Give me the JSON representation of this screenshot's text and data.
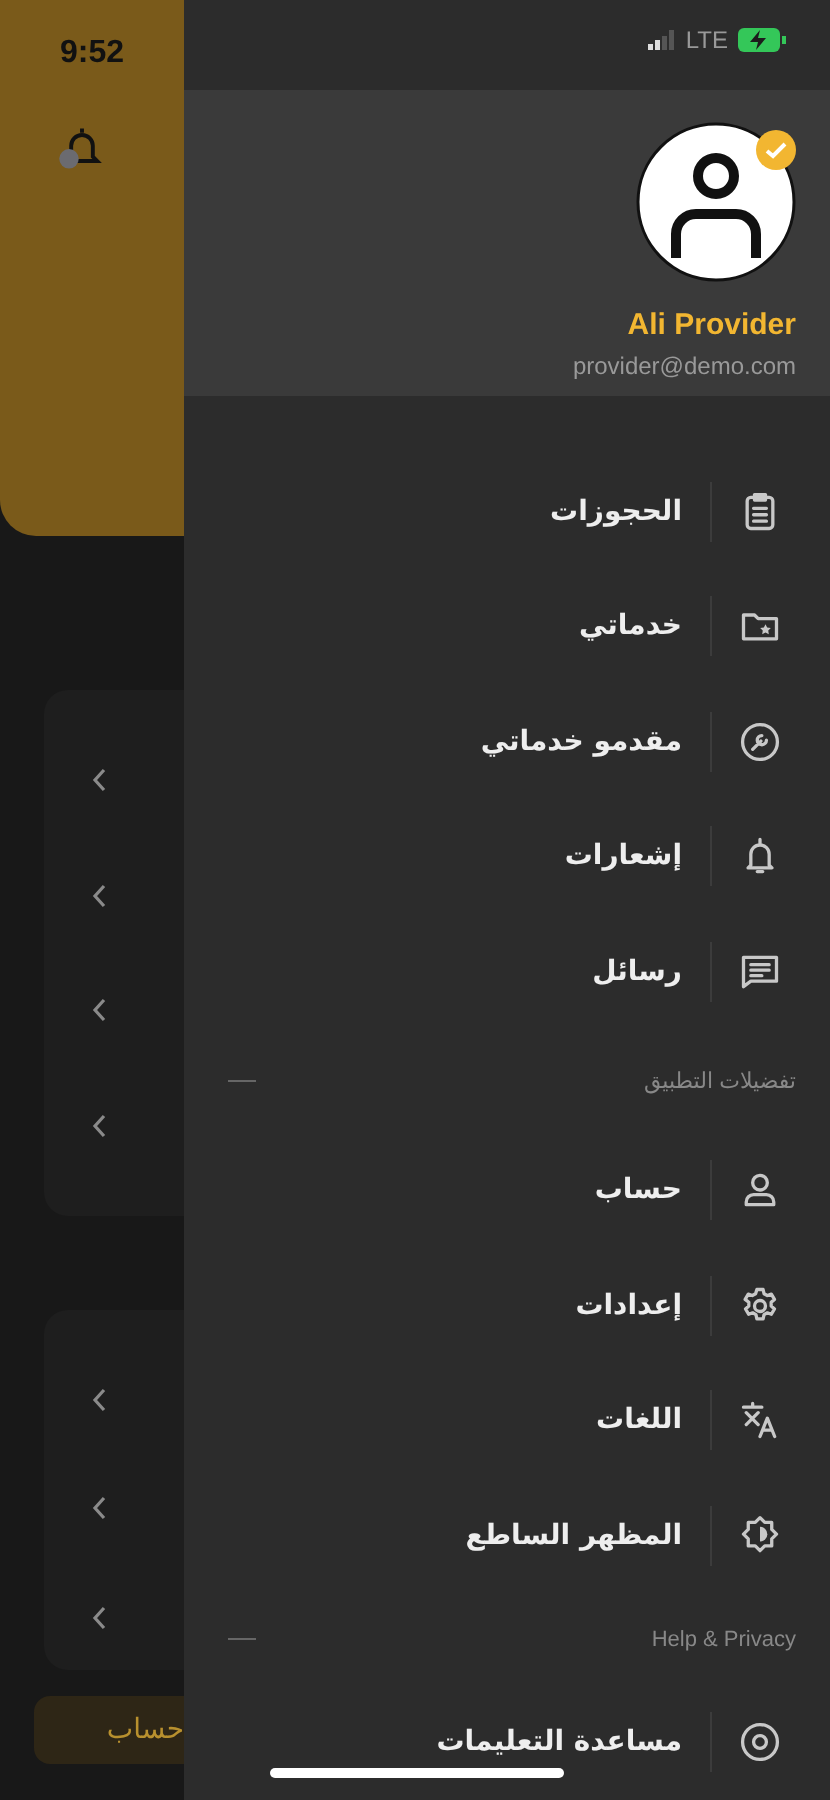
{
  "status_bar": {
    "time": "9:52",
    "network": "LTE"
  },
  "background_screen": {
    "bottom_tab": "حساب"
  },
  "drawer": {
    "profile": {
      "name": "Ali Provider",
      "email": "provider@demo.com",
      "verified": true
    },
    "sections": [
      {
        "items": [
          {
            "label": "الحجوزات"
          },
          {
            "label": "خدماتي"
          },
          {
            "label": "مقدمو خدماتي"
          },
          {
            "label": "إشعارات"
          },
          {
            "label": "رسائل"
          }
        ]
      },
      {
        "title": "تفضيلات التطبيق",
        "items": [
          {
            "label": "حساب"
          },
          {
            "label": "إعدادات"
          },
          {
            "label": "اللغات"
          },
          {
            "label": "المظهر الساطع"
          }
        ]
      },
      {
        "title": "Help & Privacy",
        "items": [
          {
            "label": "مساعدة التعليمات"
          }
        ]
      }
    ]
  }
}
